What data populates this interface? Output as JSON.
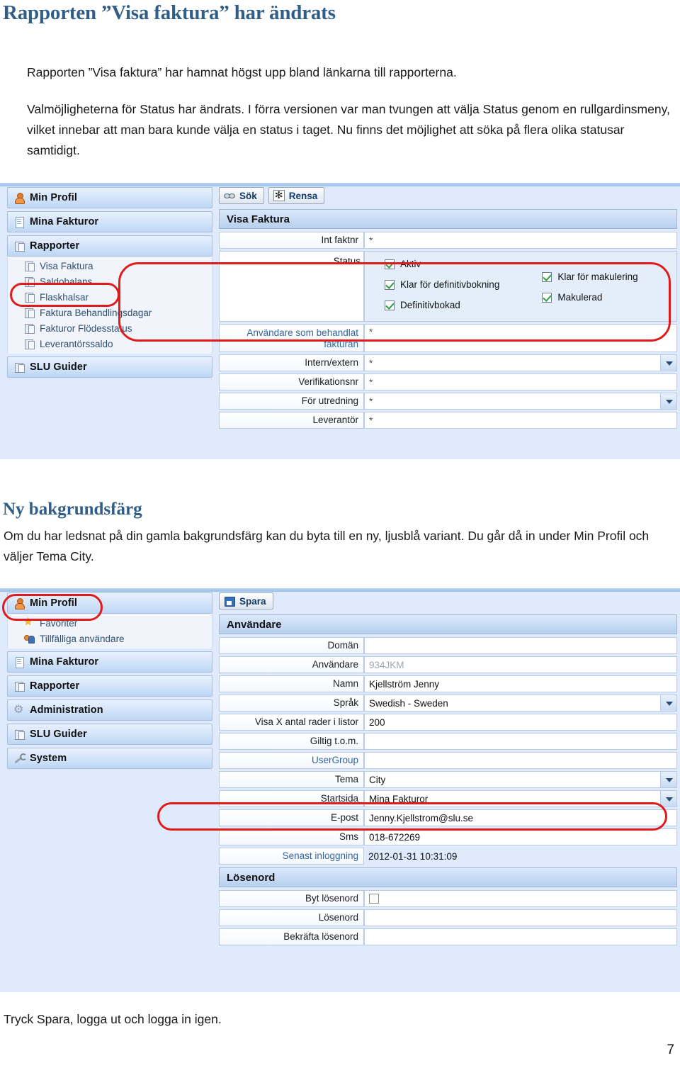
{
  "document": {
    "title": "Rapporten ”Visa faktura” har ändrats",
    "para1": "Rapporten ”Visa faktura” har hamnat högst upp bland länkarna till rapporterna.",
    "para2": "Valmöjligheterna för Status har ändrats. I förra versionen var man tvungen att välja Status genom en rullgardinsmeny, vilket innebar att man bara kunde välja en status i taget. Nu finns det möjlighet att söka på flera olika statusar samtidigt.",
    "subtitle": "Ny bakgrundsfärg",
    "para3": "Om du har ledsnat på din gamla bakgrundsfärg kan du byta till en ny, ljusblå variant. Du går då in under Min Profil och väljer Tema City.",
    "para4": "Tryck Spara, logga ut och logga in igen.",
    "page_number": "7",
    "heading_color": "#315E86"
  },
  "screenshot1": {
    "sidebar": {
      "groups": [
        {
          "label": "Min Profil",
          "icon": "person-icon"
        },
        {
          "label": "Mina Fakturor",
          "icon": "document-icon"
        },
        {
          "label": "Rapporter",
          "icon": "report-icon"
        }
      ],
      "report_children": [
        {
          "label": "Visa Faktura",
          "icon": "report-icon",
          "highlighted": true
        },
        {
          "label": "Saldobalans",
          "icon": "report-icon"
        },
        {
          "label": "Flaskhalsar",
          "icon": "report-icon"
        },
        {
          "label": "Faktura Behandlingsdagar",
          "icon": "report-icon"
        },
        {
          "label": "Fakturor Flödesstatus",
          "icon": "report-icon"
        },
        {
          "label": "Leverantörssaldo",
          "icon": "report-icon"
        }
      ],
      "last_group": {
        "label": "SLU Guider",
        "icon": "report-icon"
      }
    },
    "toolbar": [
      {
        "label": "Sök",
        "icon": "search-icon"
      },
      {
        "label": "Rensa",
        "icon": "asterisk-icon"
      }
    ],
    "panel_title": "Visa Faktura",
    "fields": [
      {
        "label": "Int faktnr",
        "value": "*",
        "type": "text"
      },
      {
        "label": "Användare som behandlat fakturan",
        "value": "*",
        "type": "text"
      },
      {
        "label": "Intern/extern",
        "value": "*",
        "type": "select"
      },
      {
        "label": "Verifikationsnr",
        "value": "*",
        "type": "text"
      },
      {
        "label": "För utredning",
        "value": "*",
        "type": "select"
      },
      {
        "label": "Leverantör",
        "value": "*",
        "type": "text"
      }
    ],
    "status": {
      "label": "Status",
      "column1": [
        {
          "label": "Aktiv",
          "checked": true
        },
        {
          "label": "Klar för definitivbokning",
          "checked": true
        },
        {
          "label": "Definitivbokad",
          "checked": true
        }
      ],
      "column2": [
        {
          "label": "Klar för makulering",
          "checked": true
        },
        {
          "label": "Makulerad",
          "checked": true
        }
      ]
    },
    "annotation_color": "#e01b1b"
  },
  "screenshot2": {
    "sidebar": {
      "items": [
        {
          "label": "Min Profil",
          "icon": "person-icon",
          "highlighted": true
        },
        {
          "label": "Mina Fakturor",
          "icon": "document-icon"
        },
        {
          "label": "Rapporter",
          "icon": "report-icon"
        },
        {
          "label": "Administration",
          "icon": "gear-icon"
        },
        {
          "label": "SLU Guider",
          "icon": "report-icon"
        },
        {
          "label": "System",
          "icon": "wrench-icon"
        }
      ],
      "profile_children": [
        {
          "label": "Favoriter",
          "icon": "star-icon"
        },
        {
          "label": "Tillfälliga användare",
          "icon": "users-icon"
        }
      ]
    },
    "toolbar": [
      {
        "label": "Spara",
        "icon": "save-icon"
      }
    ],
    "panel_title": "Användare",
    "fields": [
      {
        "label": "Domän",
        "value": "",
        "type": "text"
      },
      {
        "label": "Användare",
        "value": "934JKM",
        "type": "readonly"
      },
      {
        "label": "Namn",
        "value": "Kjellström Jenny",
        "type": "text"
      },
      {
        "label": "Språk",
        "value": "Swedish - Sweden",
        "type": "select"
      },
      {
        "label": "Visa X antal rader i listor",
        "value": "200",
        "type": "text"
      },
      {
        "label": "Giltig t.o.m.",
        "value": "",
        "type": "text"
      },
      {
        "label": "UserGroup",
        "value": "",
        "type": "text",
        "muted": true
      },
      {
        "label": "Tema",
        "value": "City",
        "type": "select",
        "highlighted": true
      },
      {
        "label": "Startsida",
        "value": "Mina Fakturor",
        "type": "select"
      },
      {
        "label": "E-post",
        "value": "Jenny.Kjellstrom@slu.se",
        "type": "text"
      },
      {
        "label": "Sms",
        "value": "018-672269",
        "type": "text"
      },
      {
        "label": "Senast inloggning",
        "value": "2012-01-31 10:31:09",
        "type": "plain",
        "muted": true
      }
    ],
    "password_section": {
      "title": "Lösenord",
      "fields": [
        {
          "label": "Byt lösenord",
          "value": "",
          "type": "checkbox",
          "checked": false
        },
        {
          "label": "Lösenord",
          "value": "",
          "type": "text"
        },
        {
          "label": "Bekräfta lösenord",
          "value": "",
          "type": "text"
        }
      ]
    },
    "annotation_color": "#e01b1b"
  }
}
